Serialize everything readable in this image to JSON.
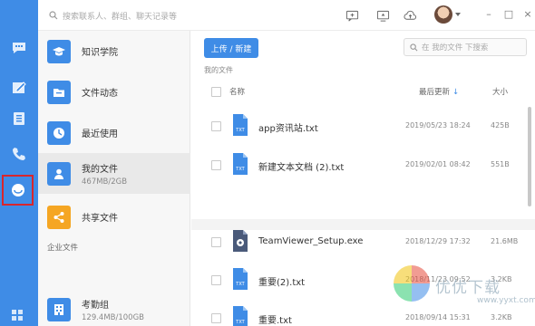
{
  "topbar": {
    "search_placeholder": "搜索联系人、群组、聊天记录等",
    "window_min": "–",
    "window_max": "□",
    "window_close": "×"
  },
  "rail": {
    "items": [
      {
        "icon": "chat-icon"
      },
      {
        "icon": "workspace-icon"
      },
      {
        "icon": "contacts-icon"
      },
      {
        "icon": "phone-icon"
      },
      {
        "icon": "cloud-drive-icon",
        "active": true
      }
    ]
  },
  "nav": {
    "items": [
      {
        "label": "知识学院",
        "icon": "graduation-cap-icon",
        "color": "#3f8ce6"
      },
      {
        "label": "文件动态",
        "icon": "folder-icon",
        "color": "#3f8ce6"
      },
      {
        "label": "最近使用",
        "icon": "clock-icon",
        "color": "#3f8ce6"
      },
      {
        "label": "我的文件",
        "sub": "467MB/2GB",
        "icon": "user-icon",
        "color": "#3f8ce6",
        "active": true
      },
      {
        "label": "共享文件",
        "icon": "share-icon",
        "color": "#f5a623"
      }
    ],
    "section_label": "企业文件",
    "enterprise": {
      "label": "考勤组",
      "sub": "129.4MB/100GB",
      "icon": "building-icon",
      "color": "#3f8ce6"
    }
  },
  "main": {
    "upload_label": "上传 / 新建",
    "search_placeholder": "在 我的文件 下搜索",
    "breadcrumb": "我的文件",
    "columns": {
      "name": "名称",
      "modified": "最后更新",
      "modified_arrow": "↓",
      "size": "大小"
    },
    "files": [
      {
        "name": "app资讯站.txt",
        "date": "2019/05/23 18:24",
        "size": "425B",
        "icon": "txt-file-icon"
      },
      {
        "name": "新建文本文档 (2).txt",
        "date": "2019/02/01 08:42",
        "size": "551B",
        "icon": "txt-file-icon"
      },
      {
        "name": "TeamViewer_Setup.exe",
        "date": "2018/12/29 17:32",
        "size": "21.6MB",
        "icon": "exe-file-icon"
      },
      {
        "name": "重要(2).txt",
        "date": "2018/11/23 09:52",
        "size": "3.2KB",
        "icon": "txt-file-icon"
      },
      {
        "name": "重要.txt",
        "date": "2018/09/14 15:31",
        "size": "3.2KB",
        "icon": "txt-file-icon"
      }
    ]
  },
  "watermark": {
    "text": "优优下载",
    "url": "www.yyxt.com"
  },
  "colors": {
    "accent": "#3f8ce6",
    "highlight_border": "#d9262c",
    "share": "#f5a623"
  }
}
